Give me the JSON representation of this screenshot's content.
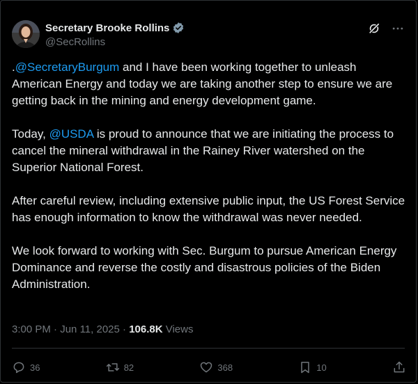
{
  "author": {
    "display_name": "Secretary Brooke Rollins",
    "handle": "@SecRollins",
    "verified_color": "#829aab",
    "avatar_icon": "profile-photo"
  },
  "accent_color": "#1d9bf0",
  "tweet": {
    "p1_prefix": ".",
    "p1_mention": "@SecretaryBurgum",
    "p1_rest": " and I have been working together to unleash American Energy and today we are taking another step to ensure we are getting back in the mining and energy development game.",
    "p2_prefix": "Today, ",
    "p2_mention": "@USDA",
    "p2_rest": " is proud to announce that we are initiating the process to cancel the mineral withdrawal in the Rainey River watershed on the Superior National Forest.",
    "p3": "After careful review, including extensive public input, the US Forest Service has enough information to know the withdrawal was never needed.",
    "p4": "We look forward to working  with Sec. Burgum to pursue American Energy Dominance and reverse the costly and disastrous policies of the Biden Administration."
  },
  "meta": {
    "time": "3:00 PM",
    "separator1": " · ",
    "date": "Jun 11, 2025",
    "separator2": " · ",
    "views_count": "106.8K",
    "views_label": " Views"
  },
  "actions": {
    "replies": "36",
    "reposts": "82",
    "likes": "368",
    "bookmarks": "10"
  }
}
